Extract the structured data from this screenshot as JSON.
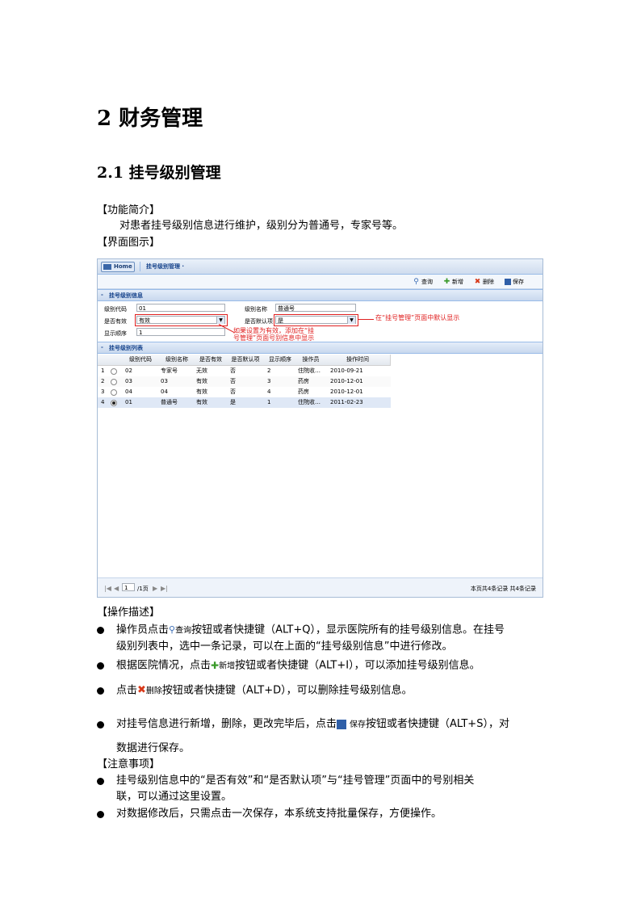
{
  "doc": {
    "h1": "2 财务管理",
    "h2": "2.1 挂号级别管理",
    "sec_intro": "【功能简介】",
    "intro_text": "对患者挂号级别信息进行维护，级别分为普通号，专家号等。",
    "sec_ui": "【界面图示】",
    "sec_ops": "【操作描述】",
    "ops": [
      {
        "pre": "操作员点击",
        "btn": "查询",
        "post": "按钮或者快捷键（ALT+Q），显示医院所有的挂号级别信息。在挂号",
        "line2": "级别列表中，选中一条记录，可以在上面的“挂号级别信息”中进行修改。"
      },
      {
        "pre": "根据医院情况，点击",
        "btn": "新增",
        "post": "按钮或者快捷键（ALT+I），可以添加挂号级别信息。"
      },
      {
        "pre": "点击",
        "btn": "删除",
        "post": "按钮或者快捷键（ALT+D），可以删除挂号级别信息。"
      },
      {
        "pre": "对挂号信息进行新增，删除，更改完毕后，点击",
        "btn": "保存",
        "post": "按钮或者快捷键（ALT+S），对",
        "line2": "数据进行保存。"
      }
    ],
    "sec_notes": "【注意事项】",
    "notes": [
      {
        "line1": "挂号级别信息中的“是否有效”和“是否默认项”与“挂号管理”页面中的号别相关",
        "line2": "联，可以通过这里设置。"
      },
      {
        "line1": "对数据修改后，只需点击一次保存，本系统支持批量保存，方便操作。"
      }
    ]
  },
  "screenshot": {
    "home_label": "Home",
    "breadcrumb": "挂号级别管理 ·",
    "toolbar": {
      "query": "查询",
      "add": "新增",
      "delete": "删除",
      "save": "保存"
    },
    "form_panel_title": "挂号级别信息",
    "form": {
      "code_label": "级别代码",
      "code_value": "01",
      "name_label": "级别名称",
      "name_value": "普通号",
      "valid_label": "是否有效",
      "valid_value": "有效",
      "default_label": "是否默认项",
      "default_value": "是",
      "order_label": "显示顺序",
      "order_value": "1"
    },
    "annotation_right": "在“挂号管理”页面中默认显示",
    "annotation_left_1": "如果设置为有效，添加在“挂",
    "annotation_left_2": "号管理”页面号别信息中显示",
    "list_panel_title": "挂号级别列表",
    "columns": [
      "级别代码",
      "级别名称",
      "是否有效",
      "是否默认项",
      "显示顺序",
      "操作员",
      "操作时间"
    ],
    "rows": [
      {
        "num": "1",
        "code": "02",
        "name": "专家号",
        "valid": "无效",
        "default": "否",
        "order": "2",
        "op": "住院收…",
        "time": "2010-09-21",
        "selected": false
      },
      {
        "num": "2",
        "code": "03",
        "name": "03",
        "valid": "有效",
        "default": "否",
        "order": "3",
        "op": "药房",
        "time": "2010-12-01",
        "selected": false
      },
      {
        "num": "3",
        "code": "04",
        "name": "04",
        "valid": "有效",
        "default": "否",
        "order": "4",
        "op": "药房",
        "time": "2010-12-01",
        "selected": false
      },
      {
        "num": "4",
        "code": "01",
        "name": "普通号",
        "valid": "有效",
        "default": "是",
        "order": "1",
        "op": "住院收…",
        "time": "2011-02-23",
        "selected": true
      }
    ],
    "pager": {
      "page_value": "1",
      "page_of": "/1页",
      "summary": "本页共4条记录 共4条记录"
    }
  },
  "colors": {
    "annotation": "#e02020",
    "panel_title": "#15428b",
    "header_bg": "#dfe8f6"
  }
}
